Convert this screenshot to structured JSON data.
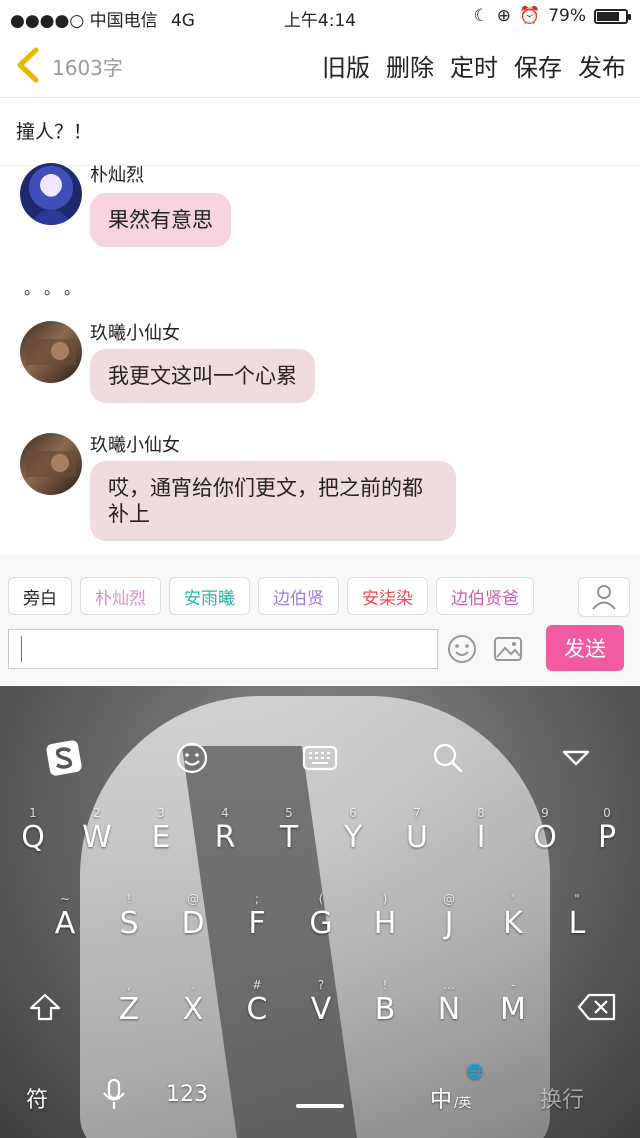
{
  "status_bar": {
    "carrier": "●●●●○ 中国电信",
    "network": "4G",
    "time": "上午4:14",
    "battery": "79%",
    "battery_level": 0.79
  },
  "toolbar": {
    "word_count": "1603字",
    "actions": [
      "旧版",
      "删除",
      "定时",
      "保存",
      "发布"
    ]
  },
  "content": {
    "caption": "撞人？！",
    "messages": [
      {
        "sender": "朴灿烈",
        "text": "果然有意思"
      },
      {
        "sender": "玖曦小仙女",
        "text": "我更文这叫一个心累"
      },
      {
        "sender": "玖曦小仙女",
        "text_line1": "哎，通宵给你们更文，把之前的都",
        "text_line2": "补上"
      }
    ],
    "ellipsis": "。。。"
  },
  "characters": [
    "旁白",
    "朴灿烈",
    "安雨曦",
    "边伯贤",
    "安柒染",
    "边伯贤爸"
  ],
  "character_colors": [
    "#222222",
    "#e58ad6",
    "#2fb3a6",
    "#a07ae0",
    "#f04c4c",
    "#d25ab0"
  ],
  "composer": {
    "input_value": "",
    "send_label": "发送"
  },
  "keyboard": {
    "row1": [
      [
        "Q",
        "1"
      ],
      [
        "W",
        "2"
      ],
      [
        "E",
        "3"
      ],
      [
        "R",
        "4"
      ],
      [
        "T",
        "5"
      ],
      [
        "Y",
        "6"
      ],
      [
        "U",
        "7"
      ],
      [
        "I",
        "8"
      ],
      [
        "O",
        "9"
      ],
      [
        "P",
        "0"
      ]
    ],
    "row2": [
      [
        "A",
        "~"
      ],
      [
        "S",
        "!"
      ],
      [
        "D",
        "@"
      ],
      [
        "F",
        ";"
      ],
      [
        "G",
        "("
      ],
      [
        "H",
        ")"
      ],
      [
        "J",
        "@"
      ],
      [
        "K",
        "'"
      ],
      [
        "L",
        "\""
      ]
    ],
    "row3": [
      [
        "Z",
        ","
      ],
      [
        "X",
        "."
      ],
      [
        "C",
        "#"
      ],
      [
        "V",
        "?"
      ],
      [
        "B",
        "!"
      ],
      [
        "N",
        "…"
      ],
      [
        "M",
        "-"
      ]
    ],
    "symbol_key": "符",
    "num_key": "123",
    "lang_key_main": "中",
    "lang_key_sub": "/英",
    "enter_key": "换行"
  }
}
